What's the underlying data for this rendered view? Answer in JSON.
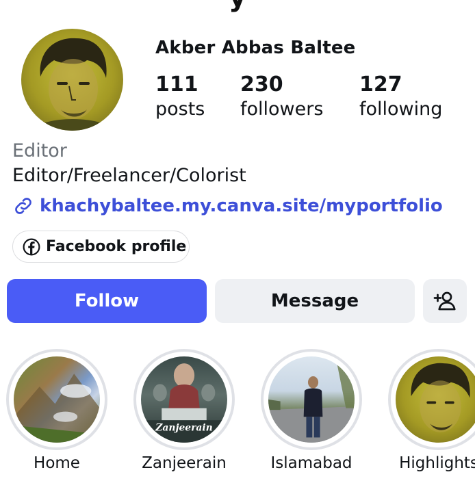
{
  "profile": {
    "top_fragment": "y",
    "name": "Akber Abbas Baltee",
    "posts_count": "111",
    "posts_label": "posts",
    "followers_count": "230",
    "followers_label": "followers",
    "following_count": "127",
    "following_label": "following",
    "category": "Editor",
    "bio": "Editor/Freelancer/Colorist",
    "link": "khachybaltee.my.canva.site/myportfolio",
    "facebook_label": "Facebook profile"
  },
  "actions": {
    "follow_label": "Follow",
    "message_label": "Message",
    "add_user_icon": "add-person-icon"
  },
  "highlights": [
    {
      "label": "Home"
    },
    {
      "label": "Zanjeerain",
      "overlay_text": "Zanjeerain"
    },
    {
      "label": "Islamabad"
    },
    {
      "label": "Highlights"
    }
  ],
  "colors": {
    "accent": "#4a5cf6",
    "link": "#3d4fd8",
    "secondary_button": "#eef0f3",
    "muted_text": "#6a7077"
  }
}
